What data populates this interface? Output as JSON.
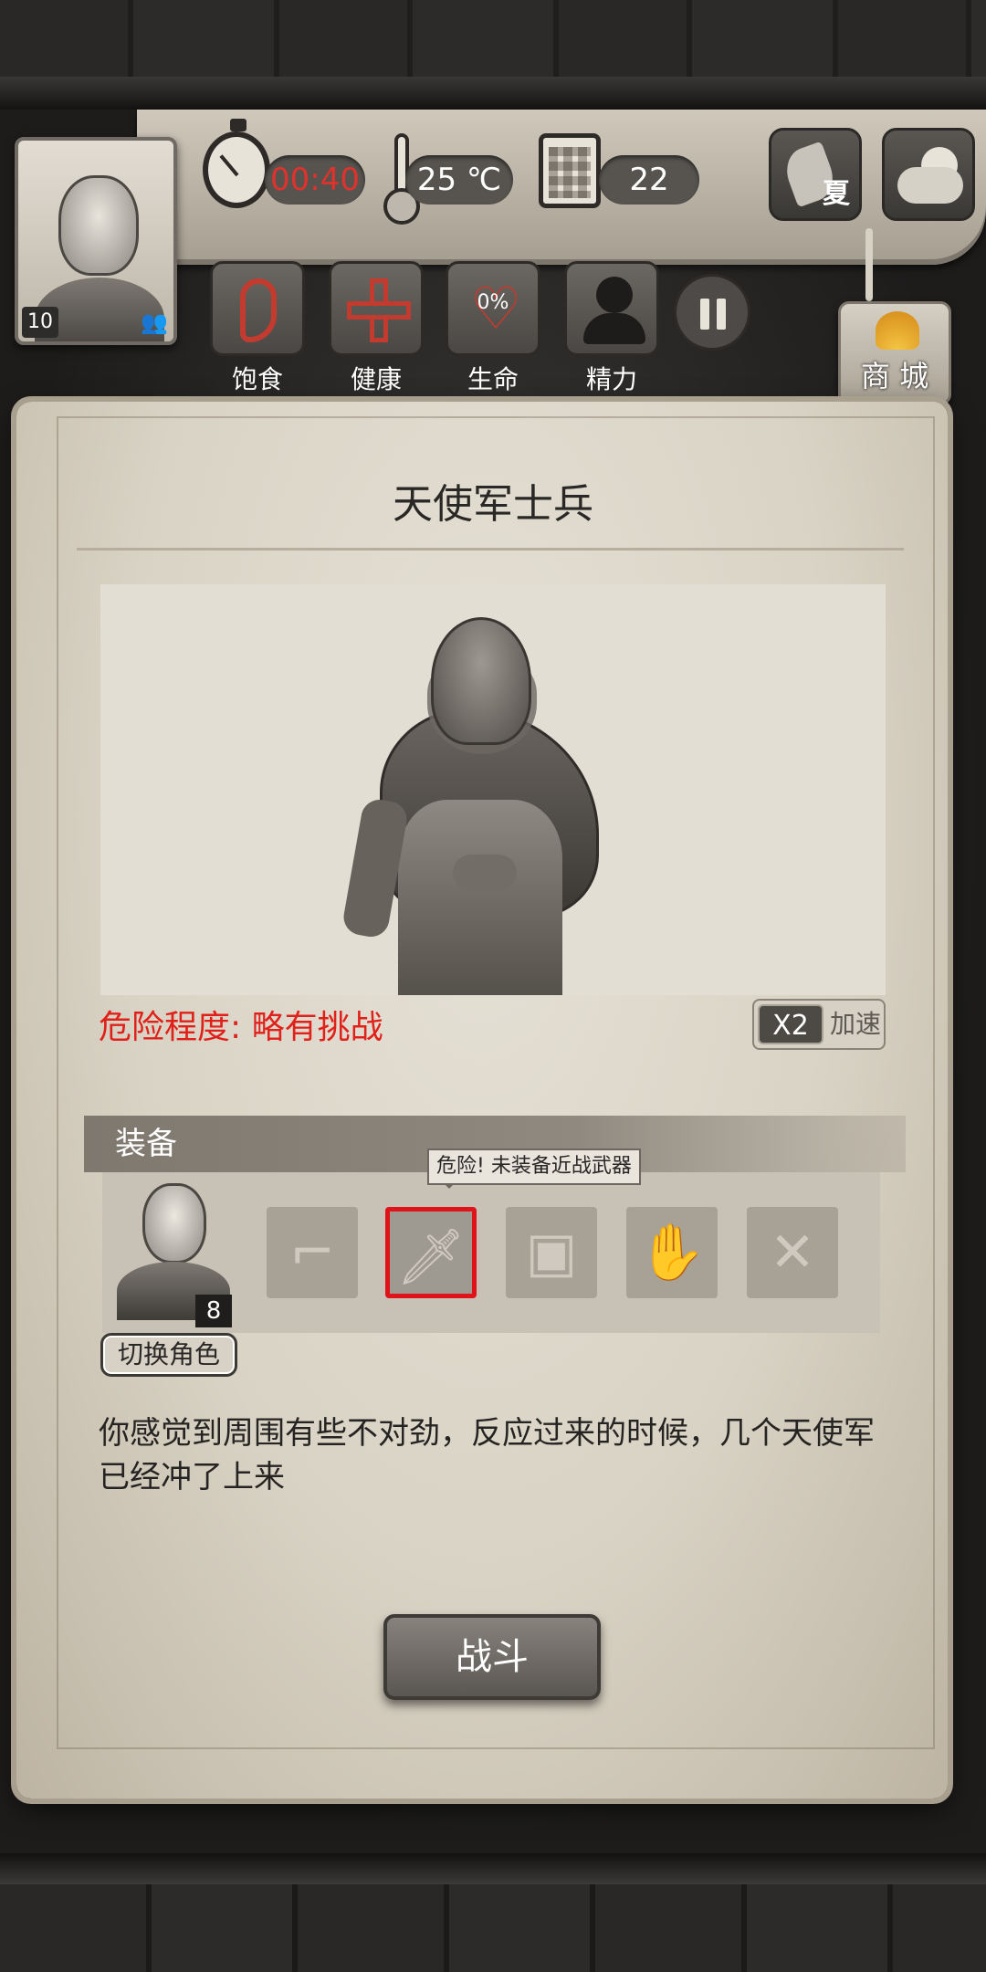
{
  "hud": {
    "time": "00:40",
    "temperature": "25 ℃",
    "day": "22",
    "season_label": "夏",
    "weather_icon": "partly-cloudy-icon",
    "portrait_level": "10",
    "stats": [
      {
        "label": "饱食",
        "icon": "stomach-icon"
      },
      {
        "label": "健康",
        "icon": "cross-icon"
      },
      {
        "label": "生命",
        "icon": "heart-icon",
        "value": "0%"
      },
      {
        "label": "精力",
        "icon": "energy-icon"
      }
    ],
    "shop_label": "商 城"
  },
  "encounter": {
    "enemy_name": "天使军士兵",
    "danger_text": "危险程度: 略有挑战",
    "speed_multiplier": "X2",
    "speed_label": "加速",
    "equip_title": "装备",
    "tooltip": "危险! 未装备近战武器",
    "character_level": "8",
    "switch_label": "切换角色",
    "slots": [
      {
        "icon": "pistol-icon",
        "highlighted": false
      },
      {
        "icon": "dagger-icon",
        "highlighted": true
      },
      {
        "icon": "armor-icon",
        "highlighted": false
      },
      {
        "icon": "glove-icon",
        "highlighted": false
      },
      {
        "icon": "arrows-icon",
        "highlighted": false
      }
    ],
    "story": "你感觉到周围有些不对劲，反应过来的时候，几个天使军已经冲了上来",
    "fight_label": "战斗"
  },
  "colors": {
    "danger": "#e0201a",
    "timer": "#e0322c",
    "slot_highlight": "#e0121a"
  }
}
